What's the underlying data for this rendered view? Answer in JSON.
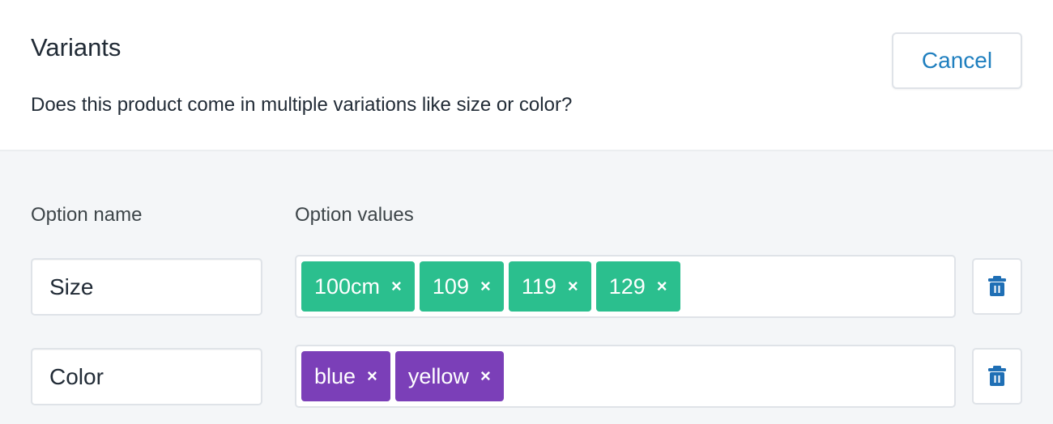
{
  "header": {
    "title": "Variants",
    "subtitle": "Does this product come in multiple variations like size or color?",
    "cancel_label": "Cancel"
  },
  "columns": {
    "option_name": "Option name",
    "option_values": "Option values"
  },
  "options": [
    {
      "name": "Size",
      "values": [
        "100cm",
        "109",
        "119",
        "129"
      ],
      "tag_color": "#2bbf8e"
    },
    {
      "name": "Color",
      "values": [
        "blue",
        "yellow"
      ],
      "tag_color": "#7b3fb8"
    }
  ],
  "icons": {
    "remove_tag": "×",
    "delete": "trash-icon"
  },
  "colors": {
    "accent": "#1f7fbf",
    "green_tag": "#2bbf8e",
    "purple_tag": "#7b3fb8"
  }
}
